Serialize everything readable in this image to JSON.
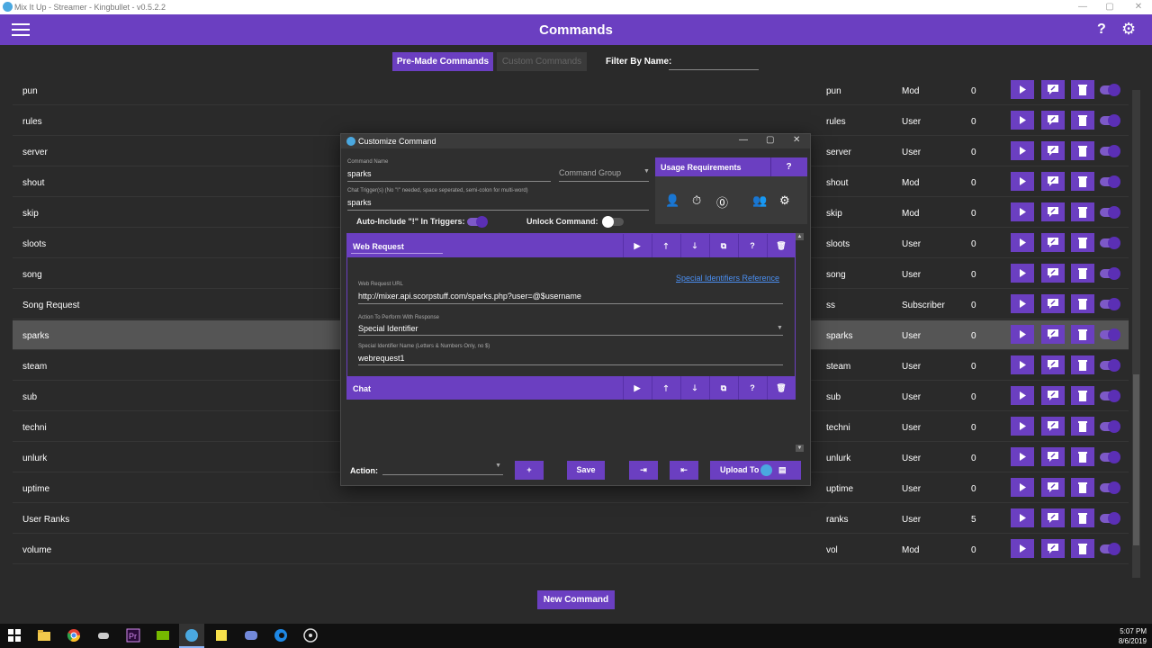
{
  "window": {
    "title": "Mix It Up - Streamer - Kingbullet - v0.5.2.2",
    "minimize": "—",
    "maximize": "▢",
    "close": "✕"
  },
  "header": {
    "title": "Commands",
    "help": "?",
    "settings_icon": "⚙"
  },
  "filters": {
    "premade_tab": "Pre-Made Commands",
    "custom_tab": "Custom Commands",
    "filter_label": "Filter By Name:",
    "filter_value": ""
  },
  "commands": [
    {
      "name": "pun",
      "trigger": "pun",
      "permission": "Mod",
      "cooldown": "0"
    },
    {
      "name": "rules",
      "trigger": "rules",
      "permission": "User",
      "cooldown": "0"
    },
    {
      "name": "server",
      "trigger": "server",
      "permission": "User",
      "cooldown": "0"
    },
    {
      "name": "shout",
      "trigger": "shout",
      "permission": "Mod",
      "cooldown": "0"
    },
    {
      "name": "skip",
      "trigger": "skip",
      "permission": "Mod",
      "cooldown": "0"
    },
    {
      "name": "sloots",
      "trigger": "sloots",
      "permission": "User",
      "cooldown": "0"
    },
    {
      "name": "song",
      "trigger": "song",
      "permission": "User",
      "cooldown": "0"
    },
    {
      "name": "Song Request",
      "trigger": "ss",
      "permission": "Subscriber",
      "cooldown": "0"
    },
    {
      "name": "sparks",
      "trigger": "sparks",
      "permission": "User",
      "cooldown": "0"
    },
    {
      "name": "steam",
      "trigger": "steam",
      "permission": "User",
      "cooldown": "0"
    },
    {
      "name": "sub",
      "trigger": "sub",
      "permission": "User",
      "cooldown": "0"
    },
    {
      "name": "techni",
      "trigger": "techni",
      "permission": "User",
      "cooldown": "0"
    },
    {
      "name": "unlurk",
      "trigger": "unlurk",
      "permission": "User",
      "cooldown": "0"
    },
    {
      "name": "uptime",
      "trigger": "uptime",
      "permission": "User",
      "cooldown": "0"
    },
    {
      "name": "User Ranks",
      "trigger": "ranks",
      "permission": "User",
      "cooldown": "5"
    },
    {
      "name": "volume",
      "trigger": "vol",
      "permission": "Mod",
      "cooldown": "0"
    }
  ],
  "new_command": "New Command",
  "dialog": {
    "title": "Customize Command",
    "command_name_label": "Command Name",
    "command_name": "sparks",
    "command_group": "Command Group",
    "triggers_label": "Chat Trigger(s) (No \"!\" needed, space seperated, semi-colon for multi-word)",
    "triggers": "sparks",
    "auto_include_label": "Auto-Include \"!\" In Triggers:",
    "auto_include_on": true,
    "unlock_label": "Unlock Command:",
    "unlock_on": false,
    "usage_title": "Usage Requirements",
    "usage_help": "?",
    "usage_icons": [
      "person-add-icon",
      "timer-icon",
      "currency-icon",
      "group-icon",
      "gear-icon"
    ],
    "web_request": {
      "title": "Web Request",
      "special_identifiers_link": "Special Identifiers Reference",
      "url_label": "Web Request URL",
      "url": "http://mixer.api.scorpstuff.com/sparks.php?user=@$username",
      "response_label": "Action To Perform With Response",
      "response": "Special Identifier",
      "identifier_label": "Special Identifier Name (Letters & Numbers Only, no $)",
      "identifier": "webrequest1"
    },
    "chat_action_title": "Chat",
    "action_label": "Action:",
    "add": "+",
    "save": "Save",
    "upload": "Upload To"
  },
  "taskbar": {
    "time": "5:07 PM",
    "date": "8/6/2019"
  }
}
